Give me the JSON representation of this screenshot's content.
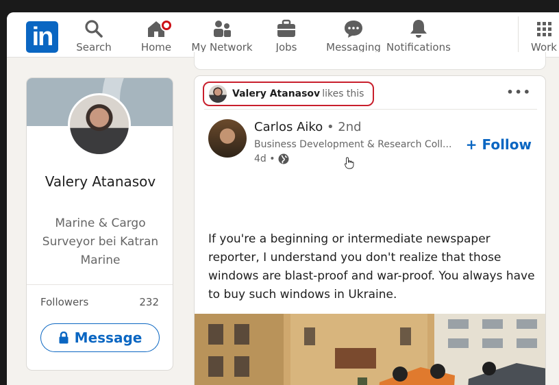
{
  "nav": {
    "logo_text": "in",
    "items": [
      {
        "label": "Search",
        "icon": "search-icon"
      },
      {
        "label": "Home",
        "icon": "home-icon"
      },
      {
        "label": "My Network",
        "icon": "network-icon"
      },
      {
        "label": "Jobs",
        "icon": "briefcase-icon"
      },
      {
        "label": "Messaging",
        "icon": "chat-icon"
      },
      {
        "label": "Notifications",
        "icon": "bell-icon"
      },
      {
        "label": "Work",
        "icon": "grid-icon"
      }
    ]
  },
  "profile": {
    "name": "Valery Atanasov",
    "headline": "Marine & Cargo Surveyor bei Katran Marine",
    "followers_label": "Followers",
    "followers_count": "232",
    "message_label": "Message"
  },
  "post": {
    "social_actor": "Valery Atanasov",
    "social_action": "likes this",
    "more_label": "•••",
    "author_name": "Carlos Aiko",
    "author_degree": "• 2nd",
    "author_headline": "Business Development & Research Coll...",
    "timestamp": "4d •",
    "follow_label": "+ Follow",
    "text": "If you're a beginning or intermediate newspaper reporter, I understand you don't realize that those windows are blast-proof and war-proof. You always have to buy such windows in Ukraine."
  },
  "colors": {
    "brand": "#0a66c2",
    "highlight": "#c81e2b",
    "badge": "#cc1016"
  }
}
